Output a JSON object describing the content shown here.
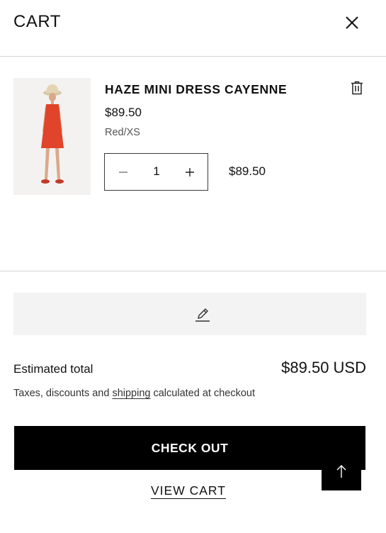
{
  "header": {
    "title": "CART",
    "close_icon": "close-icon"
  },
  "item": {
    "name": "HAZE MINI DRESS CAYENNE",
    "price": "$89.50",
    "variant": "Red/XS",
    "quantity": "1",
    "line_total": "$89.50",
    "image_description": "model wearing red mini dress and bucket hat",
    "remove_icon": "trash-icon",
    "decrease_icon": "minus-icon",
    "increase_icon": "plus-icon"
  },
  "note": {
    "icon": "pencil-icon"
  },
  "summary": {
    "estimated_label": "Estimated total",
    "estimated_value": "$89.50 USD",
    "tax_prefix": "Taxes, discounts and ",
    "tax_link": "shipping",
    "tax_suffix": " calculated at checkout"
  },
  "actions": {
    "checkout_label": "CHECK OUT",
    "view_cart_label": "VIEW CART",
    "scroll_top_icon": "arrow-up-icon"
  },
  "colors": {
    "primary": "#000000",
    "note_bg": "#f3f3f3",
    "divider": "#d6d6d6",
    "dress": "#e0442a"
  }
}
